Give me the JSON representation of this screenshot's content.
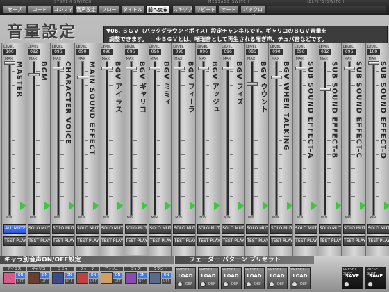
{
  "topbar": {
    "groups": [
      "SYSTEM SWITCH",
      "MESSAGE SWITCH",
      "HELP(F1)SWITCH"
    ],
    "buttons": [
      "セーブ",
      "ロード",
      "コンフィグ",
      "音声設定",
      "フロー",
      "タイトル",
      "前へ戻る",
      "スキップ",
      "リピート",
      "オート",
      "バックログ"
    ]
  },
  "panel": {
    "title": "音量設定",
    "info_line1": "▼06. ＢＧＶ（バックグラウンドボイス）設定チャンネルです。ギャリコのＢＧＶ音量を",
    "info_line2": "調整できます。　　※ＢＧＶとは、喘瑞音として再生される喘ぎ声、チュパ音などです。"
  },
  "labels": {
    "level": "LEVEL",
    "max": "MAX",
    "min": "MIN",
    "all_mute": "ALL MUTE",
    "solo_mute": "SOLO MUTE",
    "test_play": "TEST PLAY",
    "all_test_stop": "ALL TEST STOP"
  },
  "channels": [
    {
      "name": "MASTER",
      "level": "100",
      "fill": 1.0
    },
    {
      "name": "BGM",
      "level": "092",
      "fill": 0.92
    },
    {
      "name": "CHARACTER VOICE",
      "level": "096",
      "fill": 0.96
    },
    {
      "name": "MAIN SOUND EFFECT",
      "level": "090",
      "fill": 0.9
    },
    {
      "name": "BGV アイラス",
      "level": "096",
      "fill": 0.96
    },
    {
      "name": "BGV ギャリコ",
      "level": "096",
      "fill": 0.96
    },
    {
      "name": "BGV ミミィ",
      "level": "096",
      "fill": 0.96
    },
    {
      "name": "BGV フィーラ",
      "level": "096",
      "fill": 0.96
    },
    {
      "name": "BGV アッジュ",
      "level": "096",
      "fill": 0.96
    },
    {
      "name": "BGV フィズ",
      "level": "096",
      "fill": 0.96
    },
    {
      "name": "BGV ウウント",
      "level": "086",
      "fill": 0.86
    },
    {
      "name": "BGV WHEN TALKING",
      "level": "090",
      "fill": 0.9
    },
    {
      "name": "SUB SOUND EFFECT-A",
      "level": "096",
      "fill": 0.96
    },
    {
      "name": "SUB SOUND EFFECT-B",
      "level": "082",
      "fill": 0.82
    },
    {
      "name": "SUB SOUND EFFECT-C",
      "level": "096",
      "fill": 0.96
    },
    {
      "name": "SUB SOUND EFFECT-D",
      "level": "100",
      "fill": 1.0
    }
  ],
  "bottom": {
    "char_title": "キャラ別音声ON/OFF設定",
    "preset_title": "フェーダー パターン プリセット",
    "on": "ON",
    "off": "OFF",
    "characters": [
      {
        "name": "アイラス",
        "color": "#d85a8a"
      },
      {
        "name": "ギャリコ",
        "color": "#6a3e2e"
      },
      {
        "name": "ミミィ",
        "color": "#3a4a8a"
      },
      {
        "name": "フィーラ",
        "color": "#c04040"
      },
      {
        "name": "アッジュ",
        "color": "#d0a060"
      },
      {
        "name": "フィズ",
        "color": "#8a4ab0"
      },
      {
        "name": "ウウント",
        "color": "#5a6a8a"
      }
    ],
    "presets": [
      {
        "tag": "PRESET",
        "label": "LOAD",
        "def": "DEF"
      },
      {
        "tag": "PRESET",
        "label": "LOAD",
        "def": "DEF"
      },
      {
        "tag": "PRESET",
        "label": "LOAD",
        "def": "DEF"
      },
      {
        "tag": "PRESET",
        "label": "LOAD",
        "def": "DEF"
      },
      {
        "tag": "PRESET",
        "label": "LOAD",
        "def": "DEF"
      },
      {
        "tag": "PRESET",
        "label": "LOAD",
        "def": "DEF"
      },
      {
        "tag": "PRESET SLOT",
        "label": "SAVE",
        "def": ""
      },
      {
        "tag": "PRESET SLOT",
        "label": "SAVE",
        "def": ""
      }
    ]
  }
}
